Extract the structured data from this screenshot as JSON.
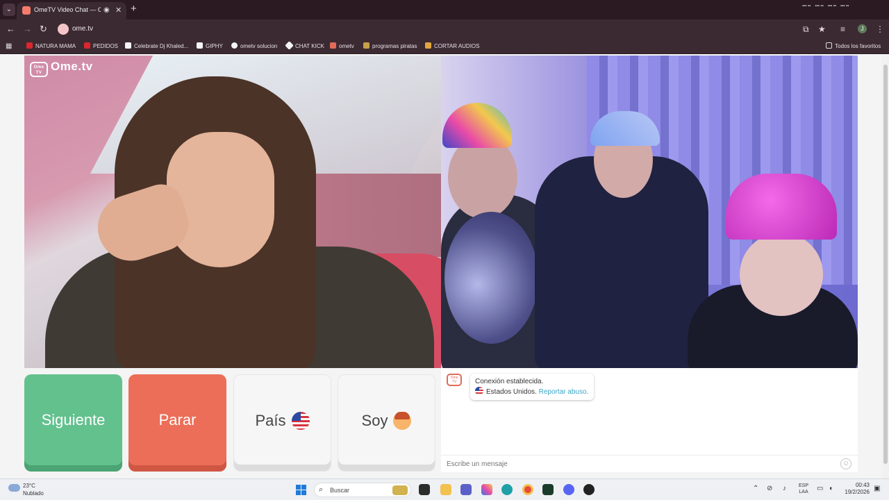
{
  "browser": {
    "tab_title": "OmeTV Video Chat — Omegle",
    "tab_menu_icon": "chevron-down-icon",
    "new_tab": "+",
    "url": "ome.tv",
    "bookmarks": [
      {
        "label": "NATURA MAMA",
        "color": "#d9262f"
      },
      {
        "label": "PEDIDOS",
        "color": "#d9262f"
      },
      {
        "label": "Celebrate Dj Khaled...",
        "color": "#f4f4f4"
      },
      {
        "label": "GIPHY",
        "color": "#f4f4f4"
      },
      {
        "label": "ometv solucion",
        "color": "#f4f4f4"
      },
      {
        "label": "CHAT KICK",
        "color": "#f4f4f4"
      },
      {
        "label": "ometv",
        "color": "#e26b59"
      },
      {
        "label": "programas piratas",
        "color": "#c7a04a"
      },
      {
        "label": "CORTAR AUDIOS",
        "color": "#e2a640"
      }
    ],
    "all_bookmarks": "Todos los favoritos"
  },
  "site": {
    "logo_text": "Ome.tv",
    "logo_box": "Ome TV"
  },
  "controls": {
    "next_label": "Siguiente",
    "stop_label": "Parar",
    "country_label": "País",
    "soy_label": "Soy"
  },
  "chat": {
    "connection_message": "Conexión establecida.",
    "country_text": "Estados Unidos.",
    "report_link": "Reportar abuso.",
    "message_placeholder": "Escribe un mensaje"
  },
  "taskbar": {
    "temperature": "23°C",
    "weather": "Nublado",
    "search_label": "Buscar",
    "lang_top": "ESP",
    "lang_bottom": "LAA",
    "time": "00:43",
    "date": "19/2/2026"
  },
  "colors": {
    "next": "#63c18e",
    "stop": "#ec6e58",
    "accent_link": "#3aa5c7"
  }
}
